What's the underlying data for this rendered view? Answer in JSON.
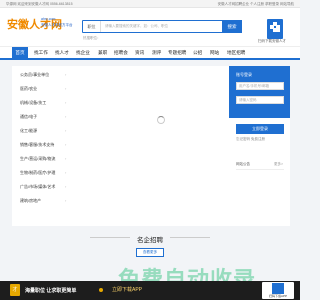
{
  "topbar": {
    "left": "华源网  欢迎来到安徽人才网   0556-6613815",
    "right": "安徽人才网招聘企业   个人注册  求职登录  网站导航"
  },
  "logo": {
    "title": "安徽人才网",
    "line1": "ahrc.com",
    "line2": "安徽人才网官方平台"
  },
  "search": {
    "category": "职位",
    "placeholder": "请输入要搜索的关键字，如：公司、职位",
    "button": "搜索",
    "hot": "热搜职位："
  },
  "qr": {
    "label": "扫码下载安徽人才"
  },
  "nav": {
    "items": [
      "首页",
      "找工作",
      "找人才",
      "找企业",
      "兼职",
      "招聘会",
      "资讯",
      "测评",
      "专题招聘",
      "公招",
      "网站",
      "地区招聘"
    ]
  },
  "categories": [
    "公务员/事业单位",
    "医药/农业",
    "机械/设备/技工",
    "通信/电子",
    "化工/能源",
    "销售/客服/技术支持",
    "生产/营运/采购/物流",
    "生物/制药/医疗/护理",
    "广告/市场/媒体/艺术",
    "建筑/房地产"
  ],
  "login_panel": {
    "title": "账号登录",
    "username_placeholder": "用户名/手机号/邮箱",
    "password_placeholder": "请输入密码",
    "login_button": "立即登录",
    "links": "忘记密码   免费注册",
    "notice": "网站公告",
    "more": "更多>"
  },
  "section": {
    "title": "名企招聘",
    "more_button": "查看更多"
  },
  "watermark": "免费自动收录",
  "bottom": {
    "badge": "才",
    "text": "海量职位 让求职更简单",
    "cta": "立即下载APP",
    "qr_label": "扫码下载APP"
  },
  "colors": {
    "brand": "#1f6fd1",
    "logo_orange": "#f08a00",
    "bottom_bar": "#1d1d1d",
    "watermark_green": "#28be78"
  }
}
